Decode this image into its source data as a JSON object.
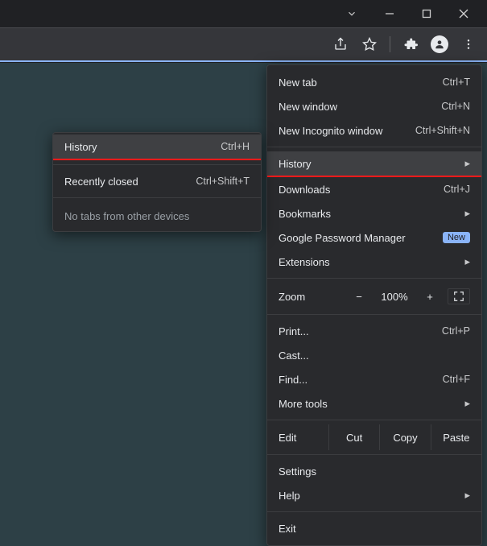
{
  "titlebar": {
    "chevron": "⌄",
    "minimize": "—",
    "maximize": "▢",
    "close": "✕"
  },
  "toolbar": {
    "share": "share-icon",
    "star": "star-icon",
    "ext": "extensions-icon",
    "avatar": "avatar",
    "menu": "⋮"
  },
  "menu": {
    "new_tab": {
      "label": "New tab",
      "shortcut": "Ctrl+T"
    },
    "new_window": {
      "label": "New window",
      "shortcut": "Ctrl+N"
    },
    "new_incognito": {
      "label": "New Incognito window",
      "shortcut": "Ctrl+Shift+N"
    },
    "history": {
      "label": "History"
    },
    "downloads": {
      "label": "Downloads",
      "shortcut": "Ctrl+J"
    },
    "bookmarks": {
      "label": "Bookmarks"
    },
    "passwords": {
      "label": "Google Password Manager",
      "badge": "New"
    },
    "extensions": {
      "label": "Extensions"
    },
    "zoom": {
      "label": "Zoom",
      "out": "−",
      "value": "100%",
      "in": "+"
    },
    "print": {
      "label": "Print...",
      "shortcut": "Ctrl+P"
    },
    "cast": {
      "label": "Cast..."
    },
    "find": {
      "label": "Find...",
      "shortcut": "Ctrl+F"
    },
    "more_tools": {
      "label": "More tools"
    },
    "edit": {
      "label": "Edit",
      "cut": "Cut",
      "copy": "Copy",
      "paste": "Paste"
    },
    "settings": {
      "label": "Settings"
    },
    "help": {
      "label": "Help"
    },
    "exit": {
      "label": "Exit"
    }
  },
  "submenu": {
    "history": {
      "label": "History",
      "shortcut": "Ctrl+H"
    },
    "recently_closed": {
      "label": "Recently closed",
      "shortcut": "Ctrl+Shift+T"
    },
    "no_tabs": "No tabs from other devices"
  }
}
